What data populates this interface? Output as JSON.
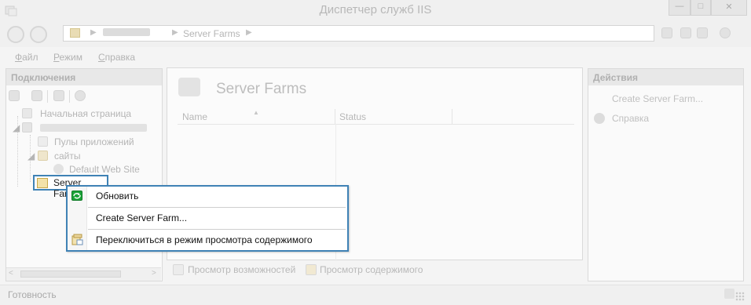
{
  "window": {
    "title": "Диспетчер служб IIS"
  },
  "address": {
    "segments": [
      "Server Farms"
    ]
  },
  "menu": {
    "items": [
      {
        "label": "Файл",
        "key": "Ф"
      },
      {
        "label": "Режим",
        "key": "Р"
      },
      {
        "label": "Справка",
        "key": "С"
      }
    ]
  },
  "connections": {
    "header": "Подключения",
    "tree": {
      "start_page": "Начальная страница",
      "app_pools": "Пулы приложений",
      "sites": "сайты",
      "default_site": "Default Web Site",
      "server_farms": "Server Farms"
    }
  },
  "center": {
    "title": "Server Farms",
    "columns": [
      "Name",
      "Status"
    ],
    "view_tabs": [
      "Просмотр возможностей",
      "Просмотр содержимого"
    ]
  },
  "actions": {
    "header": "Действия",
    "items": [
      "Create Server Farm...",
      "Справка"
    ]
  },
  "status": {
    "text": "Готовность"
  },
  "context_menu": {
    "items": [
      {
        "label": "Обновить",
        "icon": "refresh-icon"
      },
      {
        "label": "Create Server Farm...",
        "icon": ""
      },
      {
        "label": "Переключиться в режим просмотра содержимого",
        "icon": "content-view-icon"
      }
    ]
  },
  "colors": {
    "selection_border": "#3f82b5",
    "refresh_green": "#1ba339"
  }
}
